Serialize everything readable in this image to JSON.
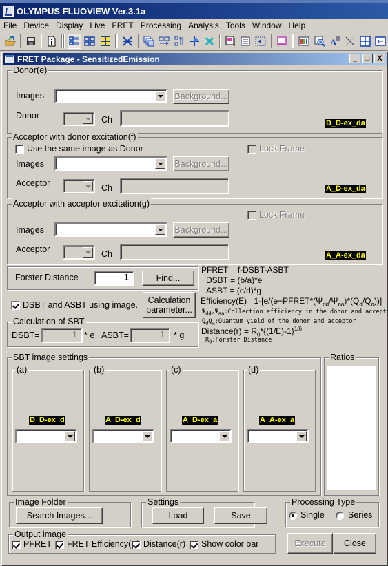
{
  "app": {
    "title": "OLYMPUS FLUOVIEW Ver.3.1a"
  },
  "menu": [
    "File",
    "Device",
    "Display",
    "Live",
    "FRET",
    "Processing",
    "Analysis",
    "Tools",
    "Window",
    "Help"
  ],
  "toolbar": {
    "icons": [
      "open-icon",
      "save-icon",
      "info-icon",
      "layout-list-icon",
      "layout-grid-icon",
      "layout-color-icon",
      "scan-icon",
      "stack-icon",
      "series-icon",
      "sort-icon",
      "move-icon",
      "cross-icon",
      "export-icon",
      "list-icon",
      "select-icon",
      "monitor-icon",
      "palette-icon",
      "zoom-icon",
      "font-icon",
      "line-icon",
      "tile-icon",
      "arrange-icon"
    ]
  },
  "dialog": {
    "title": "FRET Package - SensitizedEmission",
    "window_buttons": {
      "minimize": "_",
      "maximize": "□",
      "close": "X"
    }
  },
  "donor": {
    "group_label": "Donor(e)",
    "images_label": "Images",
    "images_value": "",
    "background_label": "Background...",
    "channel_label": "Donor",
    "ch_label": "Ch",
    "ch_value": "",
    "tag": "D_D-ex_da"
  },
  "acceptor_donor_ex": {
    "group_label": "Acceptor with donor excitation(f)",
    "same_image_label": "Use the same image as Donor",
    "same_image_checked": false,
    "lock_frame_label": "Lock Frame",
    "images_label": "Images",
    "images_value": "",
    "background_label": "Background...",
    "channel_label": "Acceptor",
    "ch_label": "Ch",
    "ch_value": "",
    "tag": "A_D-ex_da"
  },
  "acceptor_acceptor_ex": {
    "group_label": "Acceptor with acceptor excitation(g)",
    "lock_frame_label": "Lock Frame",
    "images_label": "Images",
    "images_value": "",
    "background_label": "Background...",
    "channel_label": "Acceptor",
    "ch_label": "Ch",
    "ch_value": "",
    "tag": "A_A-ex_da"
  },
  "forster": {
    "label": "Forster Distance",
    "value": "1",
    "find_label": "Find..."
  },
  "sbt_option": {
    "checkbox_label": "DSBT and ASBT using image.",
    "checked": true,
    "calc_param_line1": "Calculation",
    "calc_param_line2": "parameter..."
  },
  "calc_sbt": {
    "group_label": "Calculation of SBT",
    "dsbt_label": "DSBT=",
    "dsbt_value": "1",
    "dsbt_suffix": "* e",
    "asbt_label": "ASBT=",
    "asbt_value": "1",
    "asbt_suffix": "* g"
  },
  "formulas": {
    "pfret": "PFRET = f-DSBT-ASBT",
    "dsbt": "DSBT = (b/a)*e",
    "asbt": "ASBT = (c/d)*g",
    "efficiency": "Efficiency(E) =1-[e/(e+PFRET*(Ψdd/Ψaa)*(Qd/Qa))]",
    "psi_note_sym": "Ψdd,Ψaa",
    "psi_note": ":Collection efficiency in the donor and acceptor channel",
    "q_note_sym": "QdQa",
    "q_note": ":Quantum yield of the donor and acceptor",
    "distance": "Distance(r) = R0*{(1/E)-1}",
    "distance_exp": "1/6",
    "r0_sym": "R0",
    "r0_note": ":Forster Distance"
  },
  "sbt_settings": {
    "group_label": "SBT image settings",
    "panels": [
      {
        "label": "(a)",
        "tag": "D_D-ex_d",
        "value": ""
      },
      {
        "label": "(b)",
        "tag": "A_D-ex_d",
        "value": ""
      },
      {
        "label": "(c)",
        "tag": "A_D-ex_a",
        "value": ""
      },
      {
        "label": "(d)",
        "tag": "A_A-ex_a",
        "value": ""
      }
    ]
  },
  "ratios": {
    "group_label": "Ratios"
  },
  "image_folder": {
    "group_label": "Image Folder",
    "search_label": "Search Images..."
  },
  "settings": {
    "group_label": "Settings",
    "load_label": "Load",
    "save_label": "Save"
  },
  "processing_type": {
    "group_label": "Processing Type",
    "options": [
      {
        "label": "Single",
        "selected": true
      },
      {
        "label": "Series",
        "selected": false
      }
    ]
  },
  "output_image": {
    "group_label": "Output image",
    "options": [
      {
        "label": "PFRET",
        "checked": true
      },
      {
        "label": "FRET Efficiency(E)",
        "checked": true
      },
      {
        "label": "Distance(r)",
        "checked": true
      },
      {
        "label": "Show color bar",
        "checked": true
      }
    ]
  },
  "actions": {
    "execute_label": "Execute",
    "close_label": "Close"
  }
}
